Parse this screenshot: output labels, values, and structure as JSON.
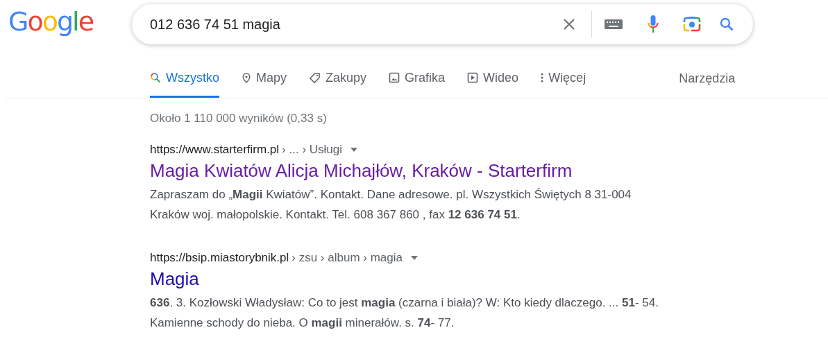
{
  "logo": "Google",
  "search": {
    "value": "012 636 74 51 magia"
  },
  "tabs": [
    {
      "label": "Wszystko",
      "kind": "all",
      "selected": true
    },
    {
      "label": "Mapy",
      "kind": "maps",
      "selected": false
    },
    {
      "label": "Zakupy",
      "kind": "shopping",
      "selected": false
    },
    {
      "label": "Grafika",
      "kind": "images",
      "selected": false
    },
    {
      "label": "Wideo",
      "kind": "video",
      "selected": false
    },
    {
      "label": "Więcej",
      "kind": "more",
      "selected": false
    }
  ],
  "tools": "Narzędzia",
  "result_stats": "Około 1 110 000 wyników (0,33 s)",
  "results": [
    {
      "url": "https://www.starterfirm.pl",
      "path": "› ... › Usługi",
      "title": "Magia Kwiatów Alicja Michajłów, Kraków - Starterfirm",
      "visited": true,
      "snippet": "Zapraszam do „**Magii** Kwiatów”. Kontakt. Dane adresowe. pl. Wszystkich Świętych 8 31-004 Kraków woj. małopolskie. Kontakt. Tel. 608 367 860 , fax **12 636 74 51**."
    },
    {
      "url": "https://bsip.miastorybnik.pl",
      "path": "› zsu › album › magia",
      "title": "Magia",
      "visited": false,
      "snippet": "**636**. 3. Kozłowski Władysław: Co to jest **magia** (czarna i biała)? W: Kto kiedy dlaczego. ... **51**- 54. Kamienne schody do nieba. O **magii** minerałów. s. **74**- 77."
    }
  ]
}
